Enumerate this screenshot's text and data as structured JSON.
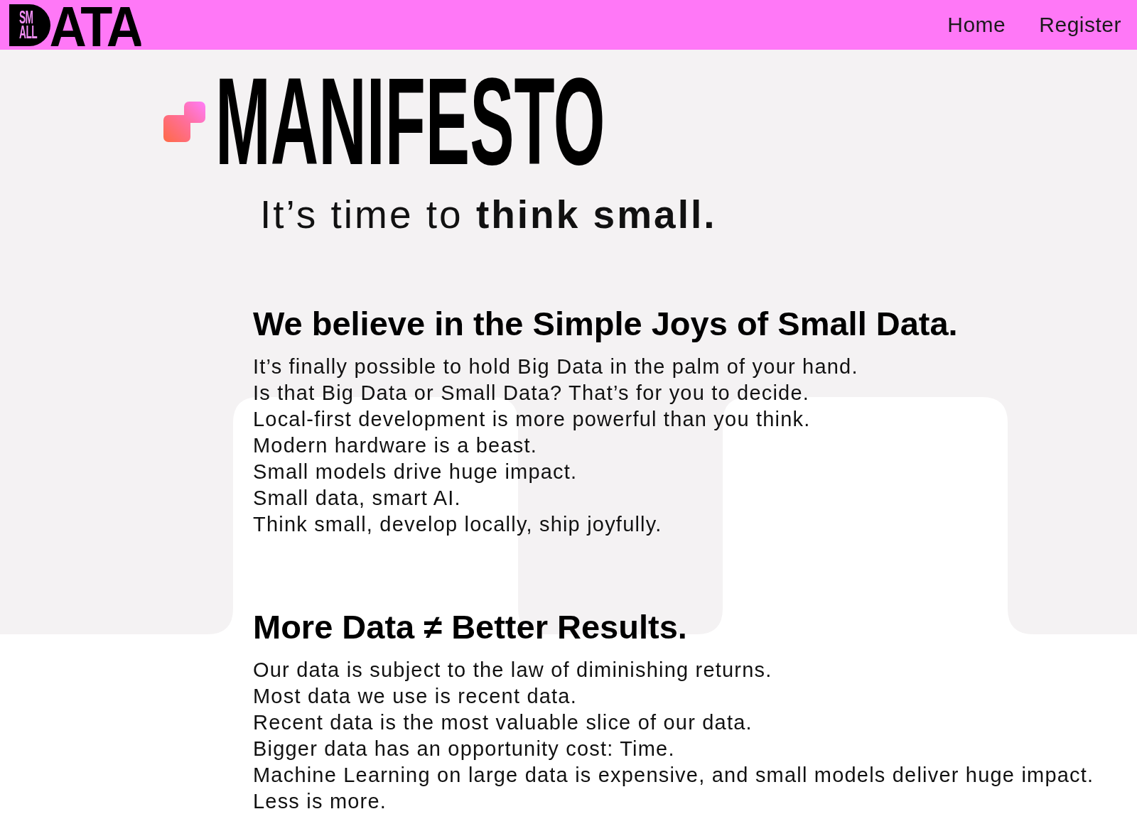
{
  "header": {
    "logo": {
      "badge_lines": [
        "SM",
        "ALL"
      ],
      "wordmark": "ATA"
    },
    "nav": [
      {
        "label": "Home"
      },
      {
        "label": "Register"
      }
    ]
  },
  "hero": {
    "title": "MANIFESTO",
    "tagline": "It’s time to **think small.**"
  },
  "sections": [
    {
      "heading": "We believe in the Simple Joys of Small Data.",
      "lines": [
        "It’s finally possible to hold Big Data in the palm of your hand.",
        "Is that Big Data or Small Data? That’s for you to decide.",
        "Local-first development is more powerful than you think.",
        "Modern hardware is a beast.",
        "Small models drive huge impact.",
        "Small data, smart AI.",
        "Think small, develop locally, ship joyfully."
      ]
    },
    {
      "heading": "More Data ≠ Better Results.",
      "lines": [
        "Our data is subject to the law of diminishing returns.",
        "Most data we use is recent data.",
        "Recent data is the most valuable slice of our data.",
        "Bigger data has an opportunity cost: Time.",
        "Machine Learning on large data is expensive, and small models deliver huge impact.",
        "Less is more."
      ]
    }
  ]
}
